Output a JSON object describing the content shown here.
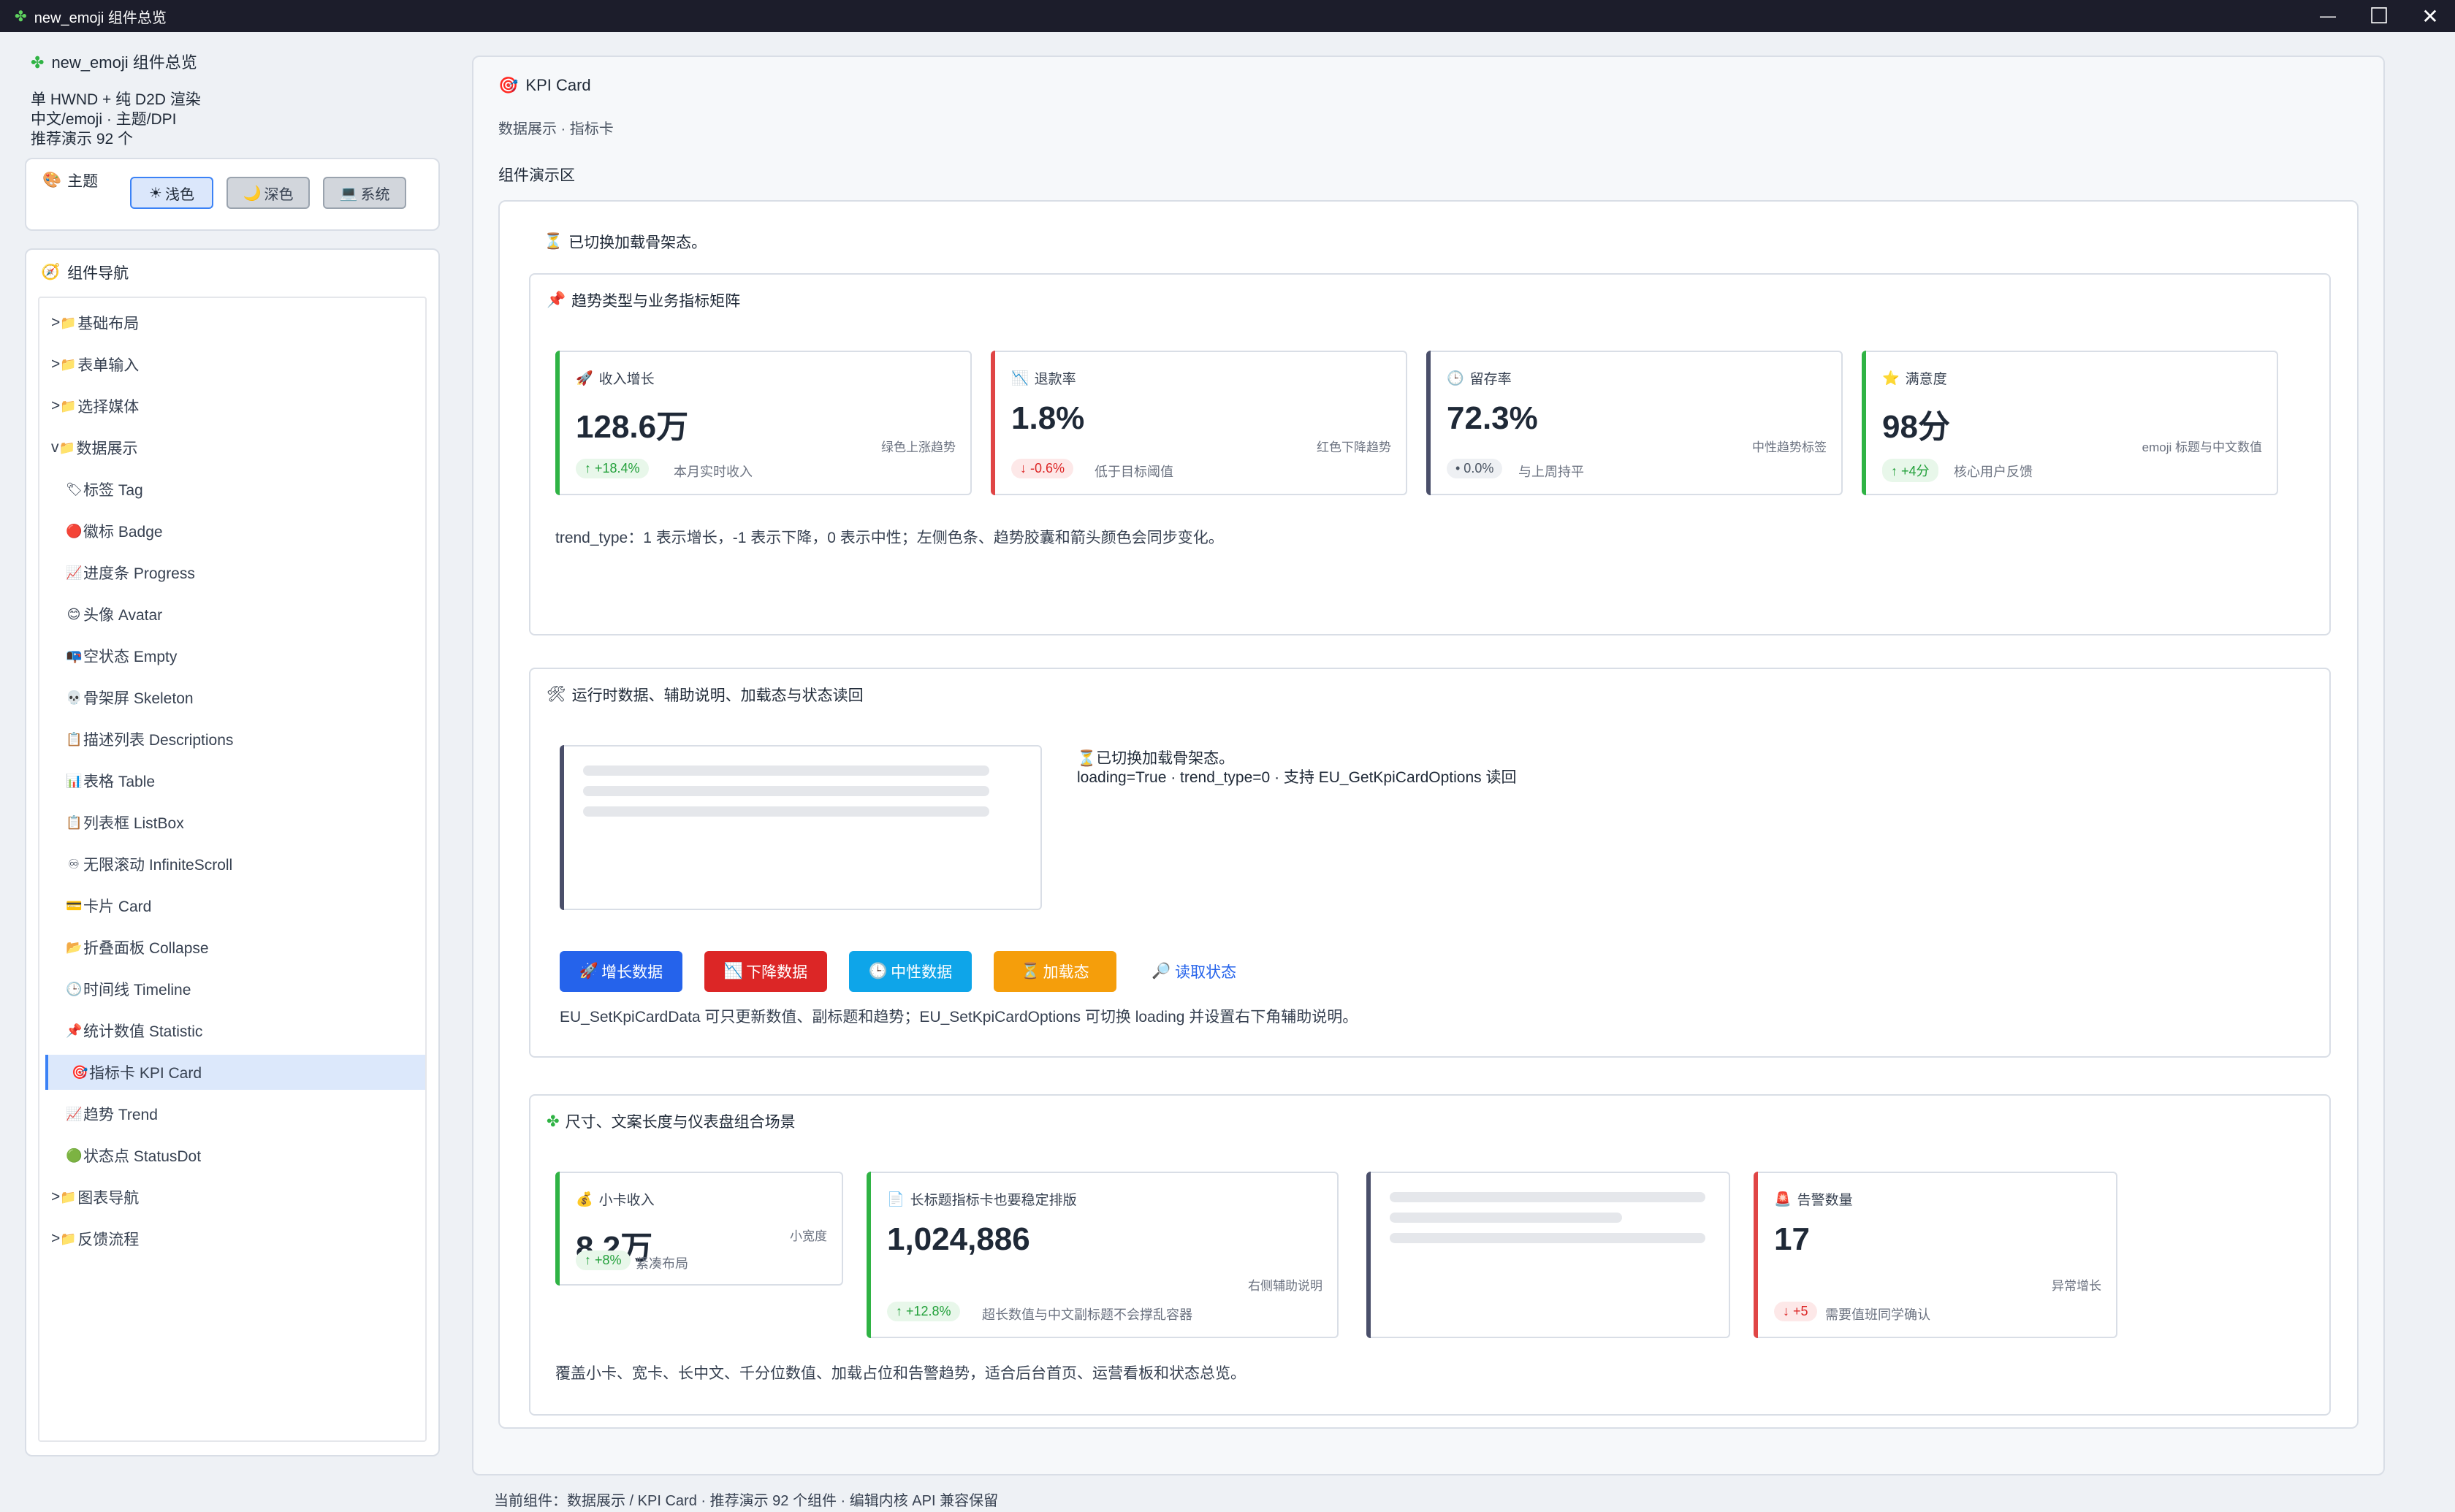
{
  "window": {
    "title": "new_emoji 组件总览",
    "minimize": "—",
    "maximize": "☐",
    "close": "✕"
  },
  "sidebar": {
    "app_name": "new_emoji 组件总览",
    "lines": [
      "单 HWND + 纯 D2D 渲染",
      "中文/emoji · 主题/DPI",
      "推荐演示 92 个"
    ],
    "theme": {
      "label": "主题",
      "buttons": [
        {
          "icon": "☀",
          "label": "浅色",
          "active": true
        },
        {
          "icon": "🌙",
          "label": "深色",
          "active": false
        },
        {
          "icon": "💻",
          "label": "系统",
          "active": false
        }
      ]
    },
    "nav_title": "组件导航",
    "nav": [
      {
        "prefix": ">",
        "icon": "📁",
        "label": "基础布局",
        "child": false
      },
      {
        "prefix": ">",
        "icon": "📁",
        "label": "表单输入",
        "child": false
      },
      {
        "prefix": ">",
        "icon": "📁",
        "label": "选择媒体",
        "child": false
      },
      {
        "prefix": "v",
        "icon": "📁",
        "label": "数据展示",
        "child": false
      },
      {
        "prefix": "",
        "icon": "🏷",
        "label": "标签 Tag",
        "child": true
      },
      {
        "prefix": "",
        "icon": "🔴",
        "label": "徽标 Badge",
        "child": true
      },
      {
        "prefix": "",
        "icon": "📈",
        "label": "进度条 Progress",
        "child": true
      },
      {
        "prefix": "",
        "icon": "😊",
        "label": "头像 Avatar",
        "child": true
      },
      {
        "prefix": "",
        "icon": "📭",
        "label": "空状态 Empty",
        "child": true
      },
      {
        "prefix": "",
        "icon": "💀",
        "label": "骨架屏 Skeleton",
        "child": true
      },
      {
        "prefix": "",
        "icon": "📋",
        "label": "描述列表 Descriptions",
        "child": true
      },
      {
        "prefix": "",
        "icon": "📊",
        "label": "表格 Table",
        "child": true
      },
      {
        "prefix": "",
        "icon": "📋",
        "label": "列表框 ListBox",
        "child": true
      },
      {
        "prefix": "",
        "icon": "♾",
        "label": "无限滚动 InfiniteScroll",
        "child": true
      },
      {
        "prefix": "",
        "icon": "💳",
        "label": "卡片 Card",
        "child": true
      },
      {
        "prefix": "",
        "icon": "📂",
        "label": "折叠面板 Collapse",
        "child": true
      },
      {
        "prefix": "",
        "icon": "🕒",
        "label": "时间线 Timeline",
        "child": true
      },
      {
        "prefix": "",
        "icon": "📌",
        "label": "统计数值 Statistic",
        "child": true
      },
      {
        "prefix": "",
        "icon": "🎯",
        "label": "指标卡 KPI Card",
        "child": true,
        "selected": true
      },
      {
        "prefix": "",
        "icon": "📈",
        "label": "趋势 Trend",
        "child": true
      },
      {
        "prefix": "",
        "icon": "🟢",
        "label": "状态点 StatusDot",
        "child": true
      },
      {
        "prefix": ">",
        "icon": "📁",
        "label": "图表导航",
        "child": false
      },
      {
        "prefix": ">",
        "icon": "📁",
        "label": "反馈流程",
        "child": false
      }
    ]
  },
  "main": {
    "title": "KPI Card",
    "subtitle": "数据展示 · 指标卡",
    "section": "组件演示区",
    "loading_note": "已切换加载骨架态。",
    "group1": {
      "title": "趋势类型与业务指标矩阵",
      "cards": [
        {
          "icon": "🚀",
          "label": "收入增长",
          "value": "128.6万",
          "trend": "↑ +18.4%",
          "trend_type": "up",
          "help": "本月实时收入",
          "note": "绿色上涨趋势",
          "color": "#2fb344"
        },
        {
          "icon": "📉",
          "label": "退款率",
          "value": "1.8%",
          "trend": "↓ -0.6%",
          "trend_type": "down",
          "help": "低于目标阈值",
          "note": "红色下降趋势",
          "color": "#e04545"
        },
        {
          "icon": "🕒",
          "label": "留存率",
          "value": "72.3%",
          "trend": "• 0.0%",
          "trend_type": "flat",
          "help": "与上周持平",
          "note": "中性趋势标签",
          "color": "#4a4f6a"
        },
        {
          "icon": "⭐",
          "label": "满意度",
          "value": "98分",
          "trend": "↑ +4分",
          "trend_type": "up",
          "help": "核心用户反馈",
          "note": "emoji 标题与中文数值",
          "color": "#2fb344"
        }
      ],
      "desc": "trend_type：1 表示增长，-1 表示下降，0 表示中性；左侧色条、趋势胶囊和箭头颜色会同步变化。"
    },
    "group2": {
      "title": "运行时数据、辅助说明、加载态与状态读回",
      "status_line1": "已切换加载骨架态。",
      "status_line2": "loading=True · trend_type=0 · 支持 EU_GetKpiCardOptions 读回",
      "buttons": [
        {
          "icon": "🚀",
          "label": "增长数据",
          "color": "#2563eb"
        },
        {
          "icon": "📉",
          "label": "下降数据",
          "color": "#dc2626"
        },
        {
          "icon": "🕒",
          "label": "中性数据",
          "color": "#0ea5e9"
        },
        {
          "icon": "⏳",
          "label": "加载态",
          "color": "#f59e0b"
        }
      ],
      "read_link": "读取状态",
      "desc": "EU_SetKpiCardData 可只更新数值、副标题和趋势；EU_SetKpiCardOptions 可切换 loading 并设置右下角辅助说明。"
    },
    "group3": {
      "title": "尺寸、文案长度与仪表盘组合场景",
      "cards": [
        {
          "icon": "💰",
          "label": "小卡收入",
          "value": "8.2万",
          "trend": "↑ +8%",
          "trend_type": "up",
          "help": "紧凑布局",
          "note": "小宽度",
          "color": "#2fb344"
        },
        {
          "icon": "📄",
          "label": "长标题指标卡也要稳定排版",
          "value": "1,024,886",
          "trend": "↑ +12.8%",
          "trend_type": "up",
          "help": "超长数值与中文副标题不会撑乱容器",
          "note": "右侧辅助说明",
          "color": "#2fb344"
        },
        {
          "icon": "🚨",
          "label": "告警数量",
          "value": "17",
          "trend": "↓ +5",
          "trend_type": "down",
          "help": "需要值班同学确认",
          "note": "异常增长",
          "color": "#e04545"
        }
      ],
      "desc": "覆盖小卡、宽卡、长中文、千分位数值、加载占位和告警趋势，适合后台首页、运营看板和状态总览。"
    }
  },
  "footer": "当前组件：数据展示 / KPI Card · 推荐演示 92 个组件 · 编辑内核 API 兼容保留"
}
